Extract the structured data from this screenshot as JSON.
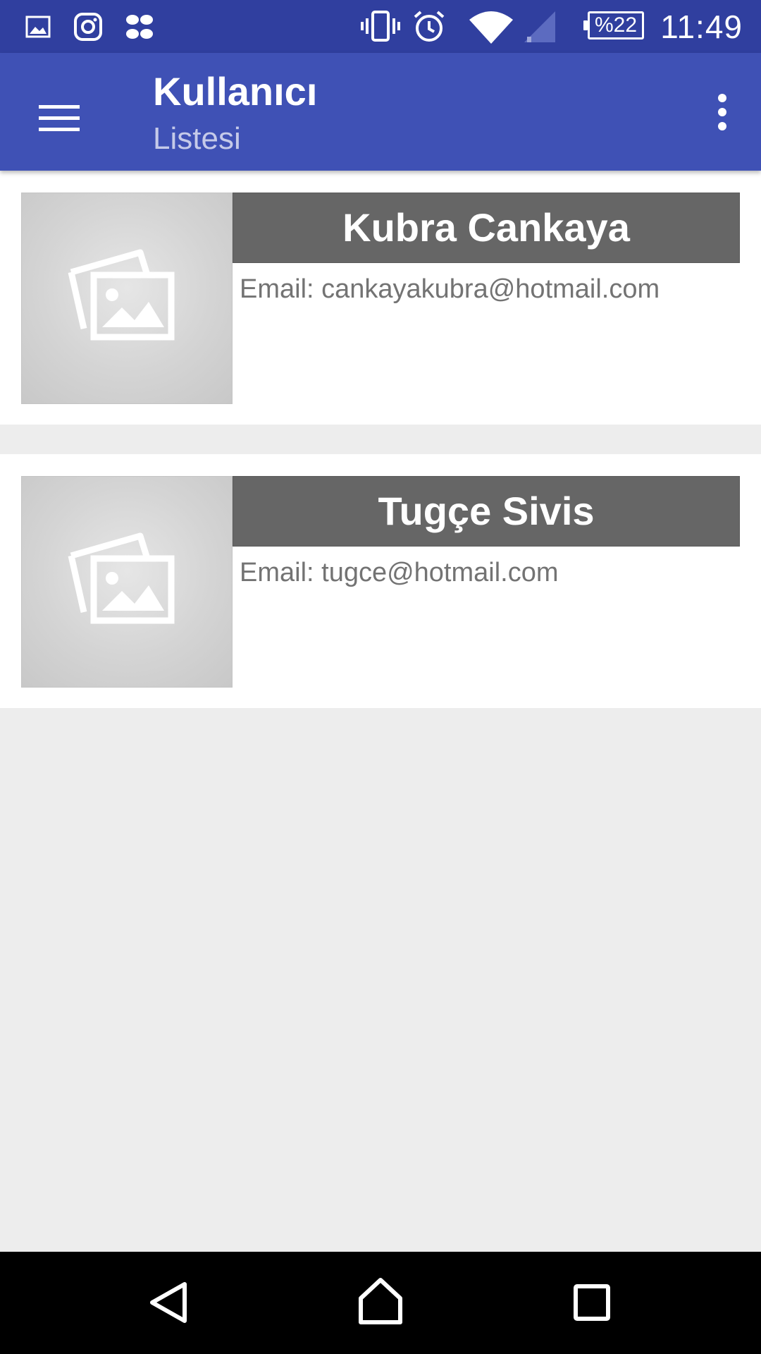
{
  "status_bar": {
    "notification_icons": [
      "image-icon",
      "instagram-icon",
      "app-icon"
    ],
    "system_icons": [
      "vibrate-icon",
      "alarm-icon",
      "wifi-icon",
      "cellular-signal-icon"
    ],
    "battery_label": "%22",
    "time": "11:49"
  },
  "app_bar": {
    "title": "Kullanıcı",
    "subtitle": "Listesi",
    "menu_icon": "hamburger-menu-icon",
    "overflow_icon": "more-vert-icon",
    "colors": {
      "primary": "#3f51b5",
      "primary_dark": "#303f9f",
      "subtitle": "#c5cae9"
    }
  },
  "users": [
    {
      "name": "Kubra Cankaya",
      "email_label": "Email: cankayakubra@hotmail.com",
      "avatar_icon": "image-placeholder-icon"
    },
    {
      "name": "Tugçe Sivis",
      "email_label": "Email: tugce@hotmail.com",
      "avatar_icon": "image-placeholder-icon"
    }
  ],
  "nav_bar": {
    "buttons": [
      "back-icon",
      "home-icon",
      "recents-icon"
    ]
  }
}
